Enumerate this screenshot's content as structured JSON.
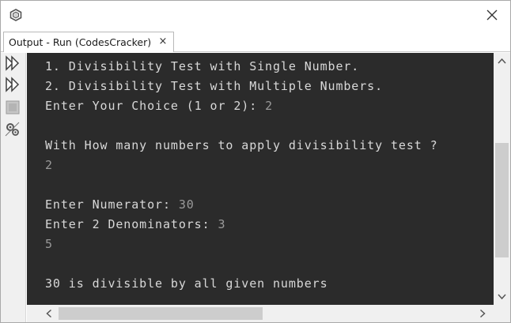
{
  "tab": {
    "label": "Output - Run (CodesCracker)",
    "close_glyph": "×"
  },
  "icons": {
    "app": "netbeans-cube-icon",
    "rerun": "rerun-icon",
    "rerun_with_options": "rerun-with-options-icon",
    "stop": "stop-icon",
    "settings": "output-settings-icon",
    "close_window": "close-icon"
  },
  "console": {
    "lines": [
      {
        "out": "1. Divisibility Test with Single Number.",
        "inp": ""
      },
      {
        "out": "2. Divisibility Test with Multiple Numbers.",
        "inp": ""
      },
      {
        "out": "Enter Your Choice (1 or 2): ",
        "inp": "2"
      },
      {
        "out": "",
        "inp": ""
      },
      {
        "out": "With How many numbers to apply divisibility test ?",
        "inp": ""
      },
      {
        "out": "",
        "inp": "2"
      },
      {
        "out": "",
        "inp": ""
      },
      {
        "out": "Enter Numerator: ",
        "inp": "30"
      },
      {
        "out": "Enter 2 Denominators: ",
        "inp": "3"
      },
      {
        "out": "",
        "inp": "5"
      },
      {
        "out": "",
        "inp": ""
      },
      {
        "out": "30 is divisible by all given numbers",
        "inp": ""
      }
    ]
  },
  "colors": {
    "console_bg": "#2b2b2b",
    "output_text": "#d8d8d8",
    "input_text": "#9a9a9a"
  }
}
